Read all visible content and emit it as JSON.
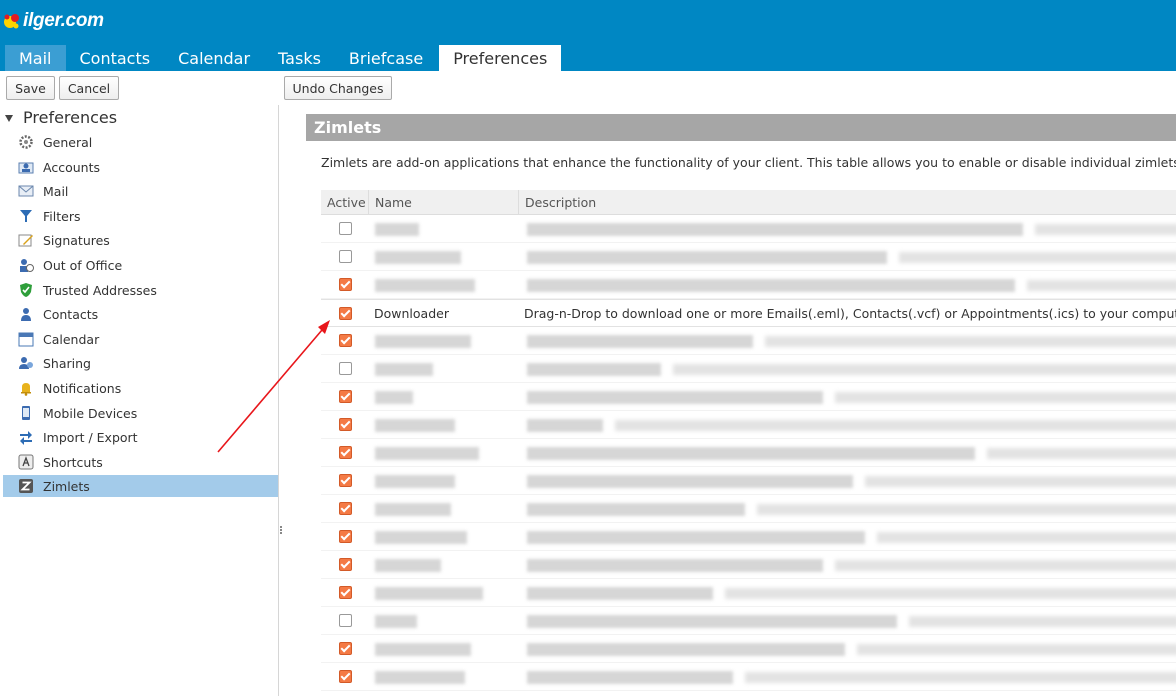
{
  "app": {
    "logo_text": "ilger.com"
  },
  "tabs": [
    {
      "label": "Mail"
    },
    {
      "label": "Contacts"
    },
    {
      "label": "Calendar"
    },
    {
      "label": "Tasks"
    },
    {
      "label": "Briefcase"
    },
    {
      "label": "Preferences",
      "active": true
    }
  ],
  "toolbar": {
    "save_label": "Save",
    "cancel_label": "Cancel",
    "undo_label": "Undo Changes"
  },
  "sidebar": {
    "title": "Preferences",
    "items": [
      {
        "label": "General",
        "icon": "gear-icon"
      },
      {
        "label": "Accounts",
        "icon": "accounts-icon"
      },
      {
        "label": "Mail",
        "icon": "envelope-icon"
      },
      {
        "label": "Filters",
        "icon": "filter-icon"
      },
      {
        "label": "Signatures",
        "icon": "signature-icon"
      },
      {
        "label": "Out of Office",
        "icon": "out-of-office-icon"
      },
      {
        "label": "Trusted Addresses",
        "icon": "shield-icon"
      },
      {
        "label": "Contacts",
        "icon": "contact-icon"
      },
      {
        "label": "Calendar",
        "icon": "calendar-icon"
      },
      {
        "label": "Sharing",
        "icon": "sharing-icon"
      },
      {
        "label": "Notifications",
        "icon": "bell-icon"
      },
      {
        "label": "Mobile Devices",
        "icon": "mobile-icon"
      },
      {
        "label": "Import / Export",
        "icon": "import-export-icon"
      },
      {
        "label": "Shortcuts",
        "icon": "keyboard-icon"
      },
      {
        "label": "Zimlets",
        "icon": "zimlet-icon",
        "selected": true
      }
    ]
  },
  "main": {
    "section_title": "Zimlets",
    "intro": "Zimlets are add-on applications that enhance the functionality of your client. This table allows you to enable or disable individual zimlets.",
    "columns": {
      "active": "Active",
      "name": "Name",
      "description": "Description"
    },
    "highlight_row": {
      "name": "Downloader",
      "description": "Drag-n-Drop to download one or more Emails(.eml), Contacts(.vcf) or Appointments(.ics) to your computer"
    },
    "rows_active": [
      false,
      false,
      true,
      true,
      true,
      false,
      true,
      true,
      true,
      true,
      true,
      true,
      true,
      true,
      false,
      true,
      true
    ]
  },
  "colors": {
    "header": "#0087c3",
    "selected": "#a3cbea",
    "checkbox_on": "#f47a45",
    "arrow": "#e8161b"
  }
}
